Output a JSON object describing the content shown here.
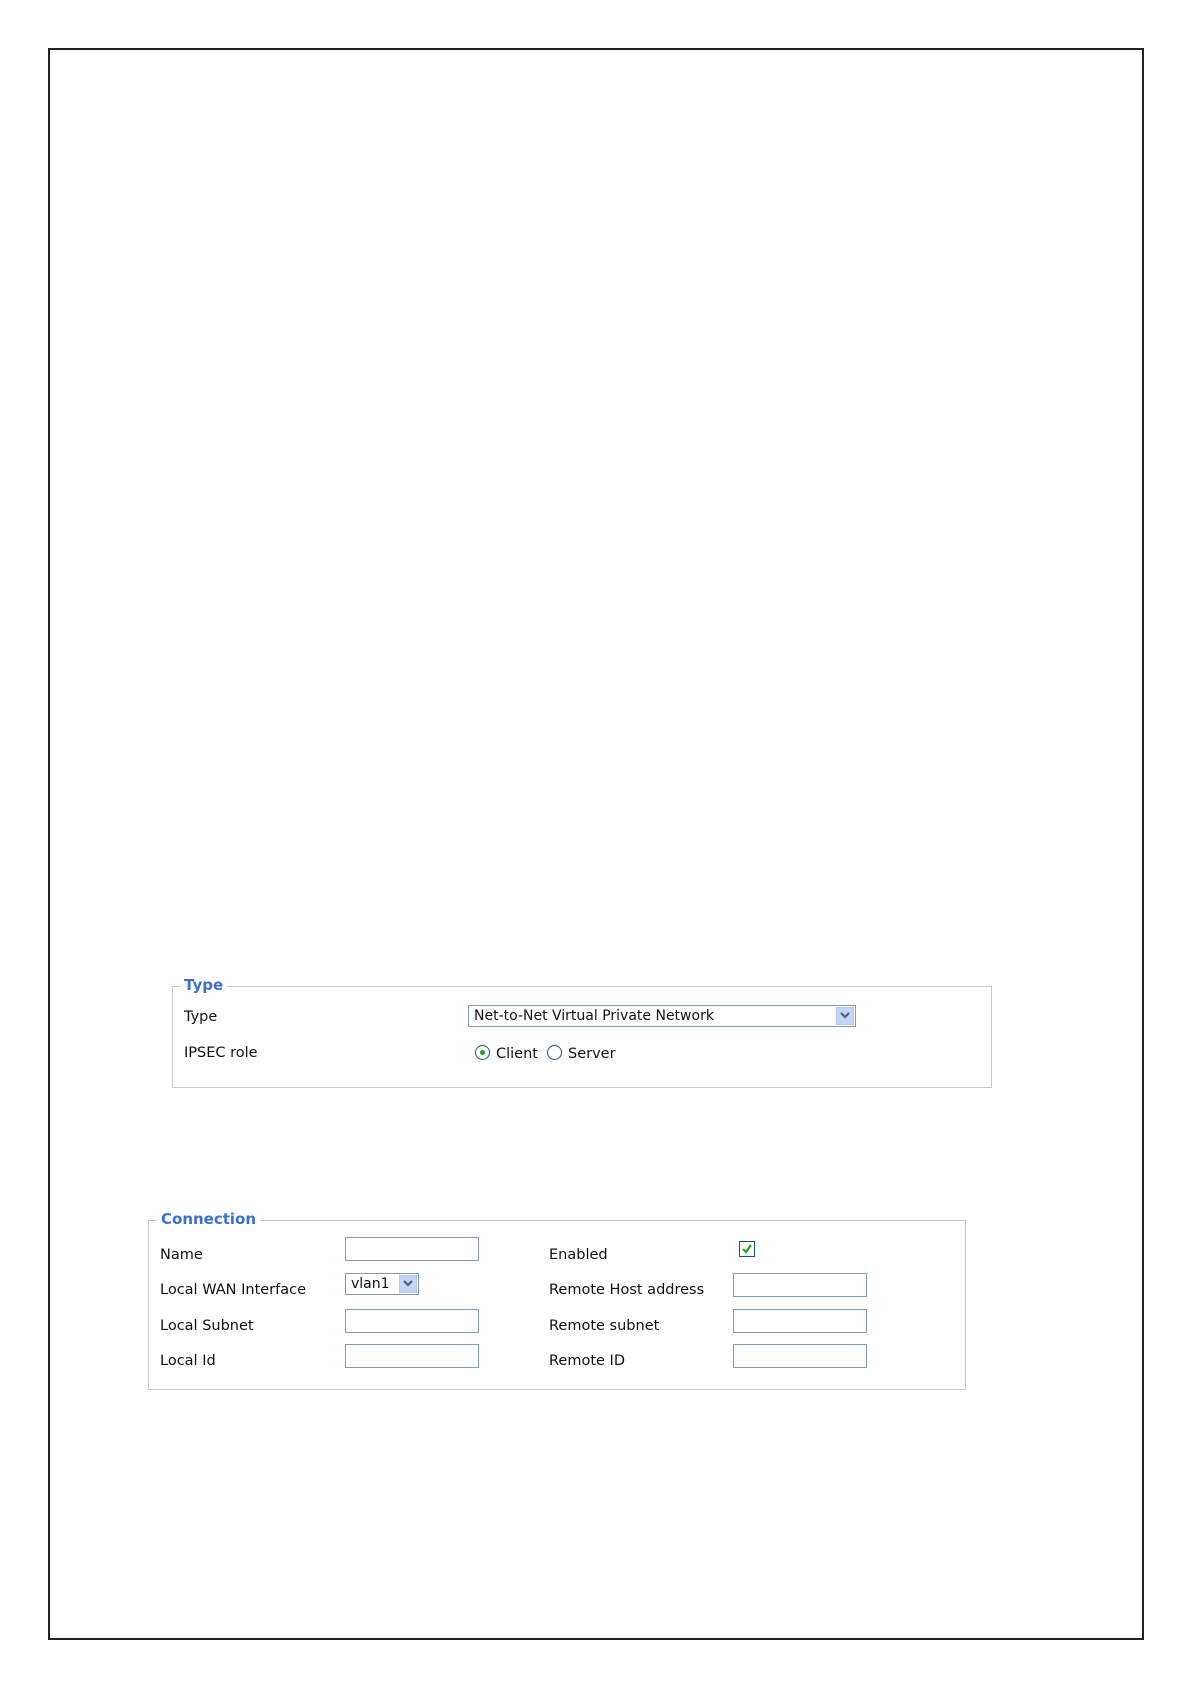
{
  "type_section": {
    "legend": "Type",
    "type_label": "Type",
    "type_value": "Net-to-Net Virtual Private Network",
    "role_label": "IPSEC role",
    "role_options": [
      "Client",
      "Server"
    ],
    "role_selected": "Client"
  },
  "connection_section": {
    "legend": "Connection",
    "name_label": "Name",
    "name_value": "",
    "wan_label": "Local WAN Interface",
    "wan_value": "vlan1",
    "local_subnet_label": "Local Subnet",
    "local_subnet_value": "",
    "local_id_label": "Local Id",
    "local_id_value": "",
    "enabled_label": "Enabled",
    "enabled_checked": true,
    "remote_host_label": "Remote Host address",
    "remote_host_value": "",
    "remote_subnet_label": "Remote subnet",
    "remote_subnet_value": "",
    "remote_id_label": "Remote ID",
    "remote_id_value": ""
  },
  "colors": {
    "legend": "#3a6fd6",
    "field_border": "#7f9db9",
    "fieldset_border": "#c8c8c8",
    "radio_dot": "#21a121",
    "check_mark": "#21a121",
    "dropdown_button": "#c5d5f6"
  },
  "icons": {
    "dropdown": "chevron-down-icon",
    "checkbox_mark": "checkmark-icon"
  }
}
